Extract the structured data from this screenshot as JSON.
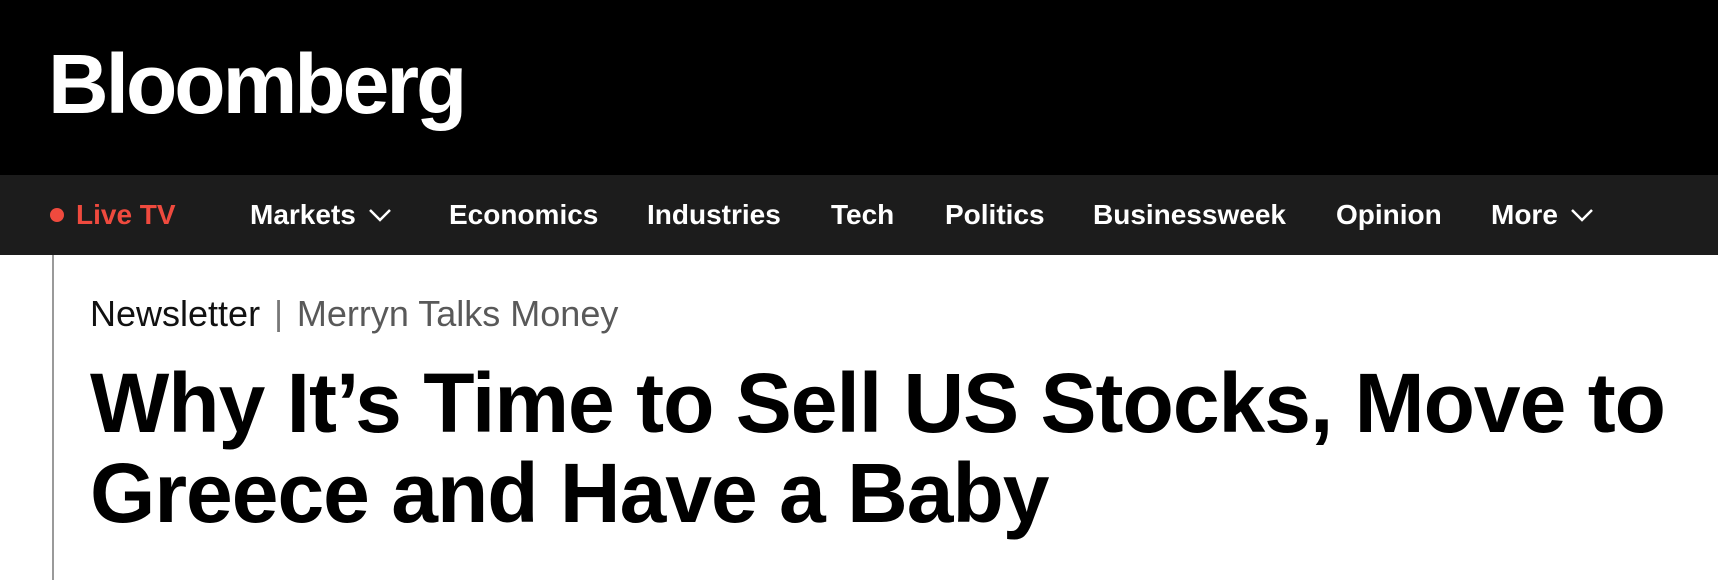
{
  "brand": {
    "logo_text": "Bloomberg"
  },
  "nav": {
    "live_tv": "Live TV",
    "items": [
      {
        "label": "Markets",
        "has_dropdown": true
      },
      {
        "label": "Economics"
      },
      {
        "label": "Industries"
      },
      {
        "label": "Tech"
      },
      {
        "label": "Politics"
      },
      {
        "label": "Businessweek"
      },
      {
        "label": "Opinion"
      },
      {
        "label": "More",
        "has_dropdown": true
      }
    ],
    "icons": {
      "live_indicator": "red-dot-icon",
      "dropdown": "chevron-down-icon"
    }
  },
  "article": {
    "kicker_label": "Newsletter",
    "kicker_separator": "|",
    "kicker_series": "Merryn Talks Money",
    "headline": "Why It’s Time to Sell US Stocks, Move to Greece and Have a Baby"
  },
  "colors": {
    "masthead_bg": "#000000",
    "nav_bg": "#1c1c1c",
    "live_accent": "#ef4a3e",
    "headline": "#000000"
  }
}
